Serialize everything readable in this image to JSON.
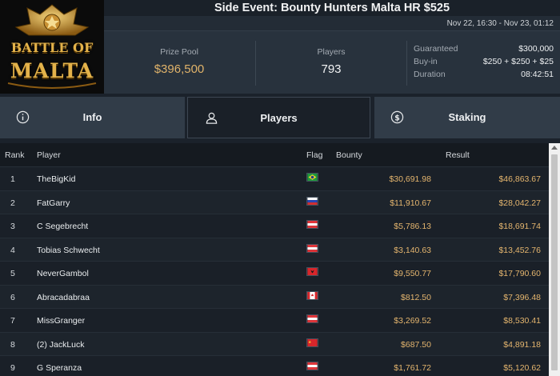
{
  "logo": {
    "line1": "BATTLE OF",
    "line2": "MALTA"
  },
  "event": {
    "title": "Side Event: Bounty Hunters Malta HR $525",
    "dates": "Nov 22, 16:30 - Nov 23, 01:12"
  },
  "stats": {
    "prize_pool_label": "Prize Pool",
    "prize_pool_value": "$396,500",
    "players_label": "Players",
    "players_value": "793",
    "guaranteed_label": "Guaranteed",
    "guaranteed_value": "$300,000",
    "buyin_label": "Buy-in",
    "buyin_value": "$250 + $250 + $25",
    "duration_label": "Duration",
    "duration_value": "08:42:51"
  },
  "tabs": [
    {
      "label": "Info",
      "icon": "info-icon"
    },
    {
      "label": "Players",
      "icon": "user-icon"
    },
    {
      "label": "Staking",
      "icon": "dollar-coin-icon"
    }
  ],
  "table": {
    "headers": {
      "rank": "Rank",
      "player": "Player",
      "flag": "Flag",
      "bounty": "Bounty",
      "result": "Result"
    },
    "rows": [
      {
        "rank": "1",
        "player": "TheBigKid",
        "flag": "brazil-flag",
        "bounty": "$30,691.98",
        "result": "$46,863.67"
      },
      {
        "rank": "2",
        "player": "FatGarry",
        "flag": "russia-flag",
        "bounty": "$11,910.67",
        "result": "$28,042.27"
      },
      {
        "rank": "3",
        "player": "C Segebrecht",
        "flag": "austria-flag",
        "bounty": "$5,786.13",
        "result": "$18,691.74"
      },
      {
        "rank": "4",
        "player": "Tobias Schwecht",
        "flag": "austria-flag",
        "bounty": "$3,140.63",
        "result": "$13,452.76"
      },
      {
        "rank": "5",
        "player": "NeverGambol",
        "flag": "albania-flag",
        "bounty": "$9,550.77",
        "result": "$17,790.60"
      },
      {
        "rank": "6",
        "player": "Abracadabraa",
        "flag": "canada-flag",
        "bounty": "$812.50",
        "result": "$7,396.48"
      },
      {
        "rank": "7",
        "player": "MissGranger",
        "flag": "austria-flag",
        "bounty": "$3,269.52",
        "result": "$8,530.41"
      },
      {
        "rank": "8",
        "player": "(2) JackLuck",
        "flag": "china-flag",
        "bounty": "$687.50",
        "result": "$4,891.18"
      },
      {
        "rank": "9",
        "player": "G Speranza",
        "flag": "austria-flag",
        "bounty": "$1,761.72",
        "result": "$5,120.62"
      }
    ]
  },
  "colors": {
    "accent_gold": "#e4b56e",
    "background": "#1b222b",
    "tab_background": "#313c48",
    "tab_active": "#1a2028"
  }
}
